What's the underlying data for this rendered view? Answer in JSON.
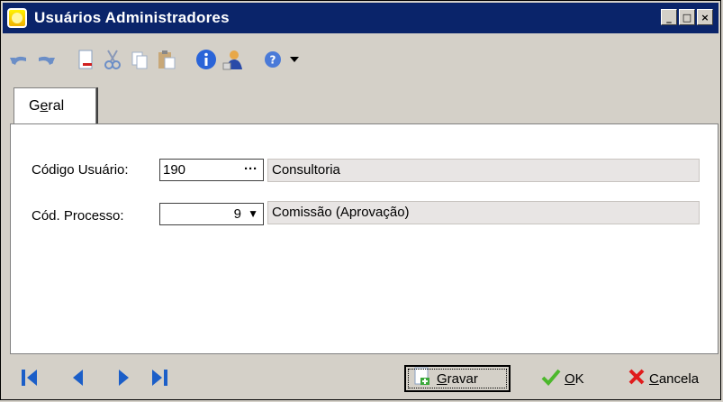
{
  "window": {
    "title": "Usuários Administradores",
    "controls": [
      "_",
      "□",
      "×"
    ]
  },
  "toolbar": {
    "icons": [
      "undo-icon",
      "redo-icon",
      "new-document-icon",
      "cut-icon",
      "copy-icon",
      "paste-icon",
      "info-icon",
      "user-icon",
      "help-icon",
      "dropdown-arrow-icon"
    ]
  },
  "tabs": [
    {
      "label_pre": "G",
      "label_u": "e",
      "label_post": "ral"
    }
  ],
  "form": {
    "codigo_usuario": {
      "label": "Código Usuário:",
      "value": "190",
      "lookup_button": "···",
      "description": "Consultoria"
    },
    "cod_processo": {
      "label": "Cód. Processo:",
      "value": "9",
      "dropdown_arrow": "▼",
      "description": "Comissão (Aprovação)"
    }
  },
  "footer": {
    "nav_icons": [
      "first-record-icon",
      "previous-record-icon",
      "next-record-icon",
      "last-record-icon"
    ],
    "gravar": {
      "u": "G",
      "rest": "ravar"
    },
    "ok": {
      "u": "O",
      "rest": "K"
    },
    "cancela": {
      "u": "C",
      "rest": "ancela"
    }
  },
  "colors": {
    "titlebar": "#0a246a",
    "window_bg": "#d4d0c8",
    "nav_blue": "#1b5ec8",
    "ok_green": "#4cb82c",
    "cancel_red": "#e01c1c"
  }
}
